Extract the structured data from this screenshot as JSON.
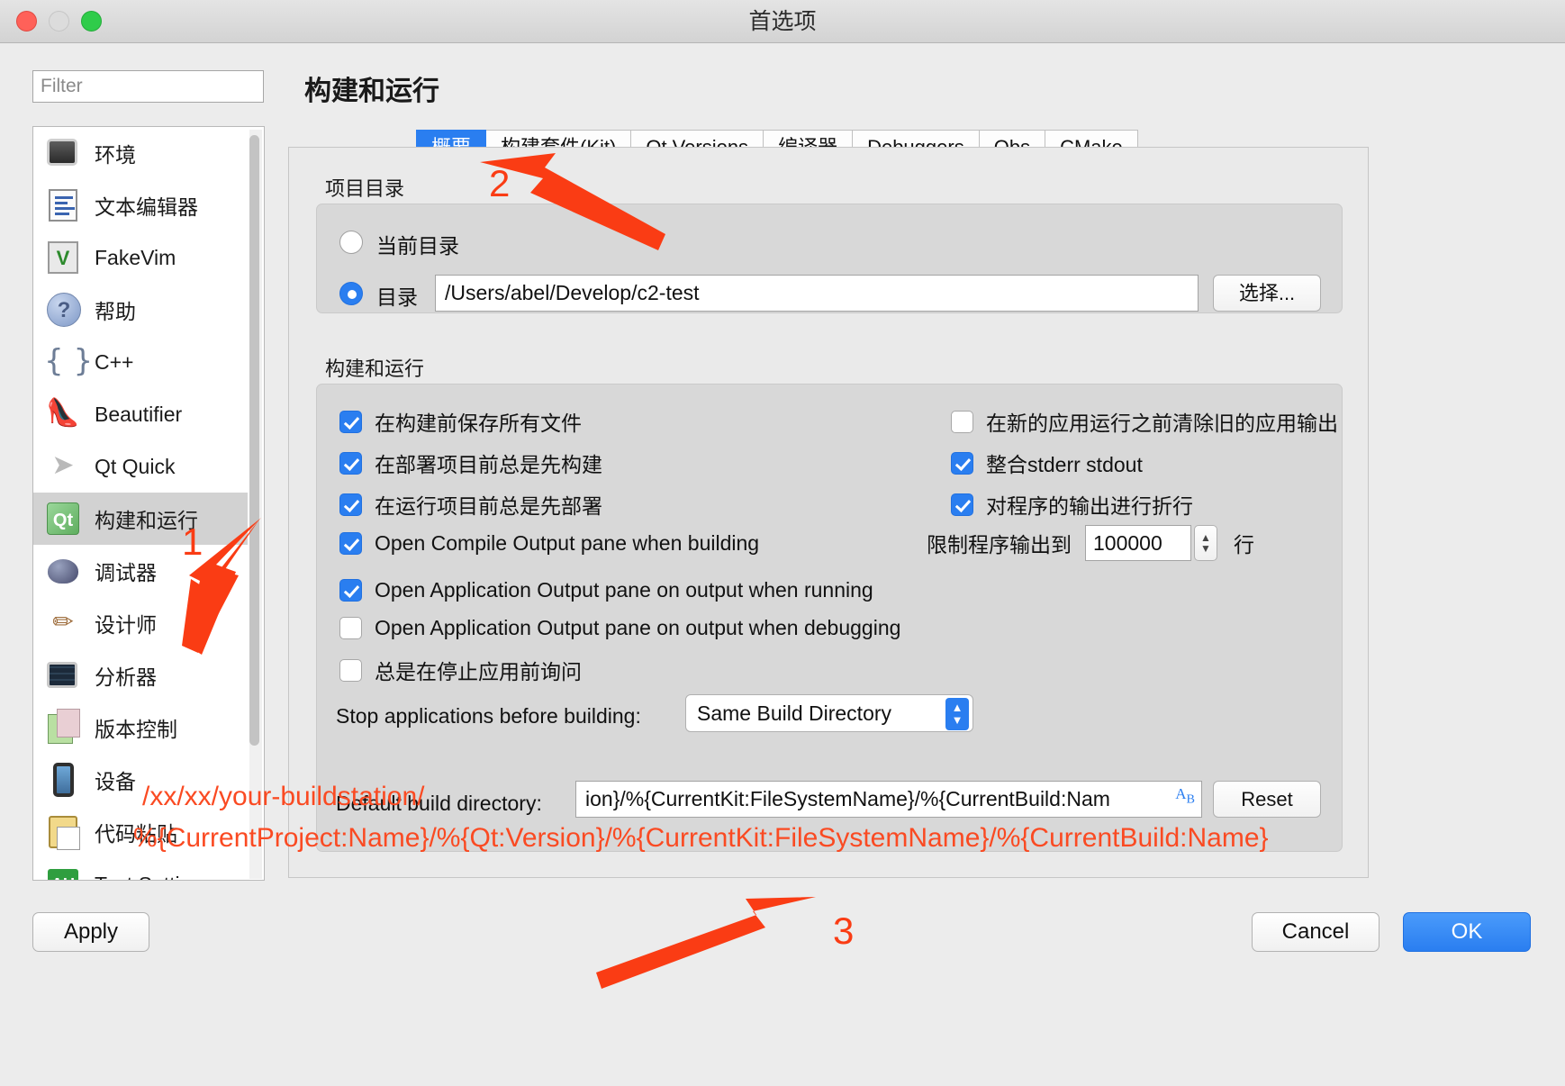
{
  "window": {
    "title": "首选项",
    "controls": [
      "close",
      "minimize",
      "zoom"
    ]
  },
  "filter": {
    "placeholder": "Filter",
    "value": ""
  },
  "sidebar": {
    "items": [
      {
        "label": "环境",
        "icon": "monitor-icon",
        "selected": false
      },
      {
        "label": "文本编辑器",
        "icon": "text-document-icon",
        "selected": false
      },
      {
        "label": "FakeVim",
        "icon": "fakevim-icon",
        "selected": false
      },
      {
        "label": "帮助",
        "icon": "help-question-icon",
        "selected": false
      },
      {
        "label": "C++",
        "icon": "braces-icon",
        "selected": false
      },
      {
        "label": "Beautifier",
        "icon": "high-heel-icon",
        "selected": false
      },
      {
        "label": "Qt Quick",
        "icon": "paper-plane-icon",
        "selected": false
      },
      {
        "label": "构建和运行",
        "icon": "qt-build-icon",
        "selected": true
      },
      {
        "label": "调试器",
        "icon": "bug-icon",
        "selected": false
      },
      {
        "label": "设计师",
        "icon": "designer-brush-icon",
        "selected": false
      },
      {
        "label": "分析器",
        "icon": "analyzer-icon",
        "selected": false
      },
      {
        "label": "版本控制",
        "icon": "version-control-icon",
        "selected": false
      },
      {
        "label": "设备",
        "icon": "device-phone-icon",
        "selected": false
      },
      {
        "label": "代码粘贴",
        "icon": "code-paste-icon",
        "selected": false
      },
      {
        "label": "Test Settings",
        "icon": "test-settings-icon",
        "selected": false
      }
    ]
  },
  "page": {
    "title": "构建和运行"
  },
  "tabs": [
    {
      "label": "概要",
      "active": true
    },
    {
      "label": "构建套件(Kit)",
      "active": false
    },
    {
      "label": "Qt Versions",
      "active": false
    },
    {
      "label": "编译器",
      "active": false
    },
    {
      "label": "Debuggers",
      "active": false
    },
    {
      "label": "Qbs",
      "active": false
    },
    {
      "label": "CMake",
      "active": false
    }
  ],
  "project_directory": {
    "group_label": "项目目录",
    "current_dir": {
      "label": "当前目录",
      "selected": false
    },
    "dir": {
      "label": "目录",
      "selected": true
    },
    "path_value": "/Users/abel/Develop/c2-test",
    "browse_button": "选择..."
  },
  "build_and_run": {
    "group_label": "构建和运行",
    "checkboxes_left": [
      {
        "label": "在构建前保存所有文件",
        "checked": true
      },
      {
        "label": "在部署项目前总是先构建",
        "checked": true
      },
      {
        "label": "在运行项目前总是先部署",
        "checked": true
      },
      {
        "label": "Open Compile Output pane when building",
        "checked": true
      },
      {
        "label": "Open Application Output pane on output when running",
        "checked": true
      },
      {
        "label": "Open Application Output pane on output when debugging",
        "checked": false
      },
      {
        "label": "总是在停止应用前询问",
        "checked": false
      }
    ],
    "checkboxes_right": [
      {
        "label": "在新的应用运行之前清除旧的应用输出",
        "checked": false
      },
      {
        "label": "整合stderr stdout",
        "checked": true
      },
      {
        "label": "对程序的输出进行折行",
        "checked": true
      }
    ],
    "output_limit": {
      "label": "限制程序输出到",
      "value": "100000",
      "unit": "行"
    },
    "stop_applications": {
      "label": "Stop applications before building:",
      "value": "Same Build Directory"
    },
    "default_build_directory": {
      "label": "Default build directory:",
      "value": "ion}/%{CurrentKit:FileSystemName}/%{CurrentBuild:Nam",
      "variable_button": "variable-icon",
      "reset_button": "Reset"
    }
  },
  "footer": {
    "apply": "Apply",
    "cancel": "Cancel",
    "ok": "OK"
  },
  "annotations": {
    "marker_1": "1",
    "marker_2": "2",
    "marker_3": "3",
    "red_line_1": "/xx/xx/your-buildstation/",
    "red_line_2": "%{CurrentProject:Name}/%{Qt:Version}/%{CurrentKit:FileSystemName}/%{CurrentBuild:Name}",
    "color": "#fa4a22"
  }
}
